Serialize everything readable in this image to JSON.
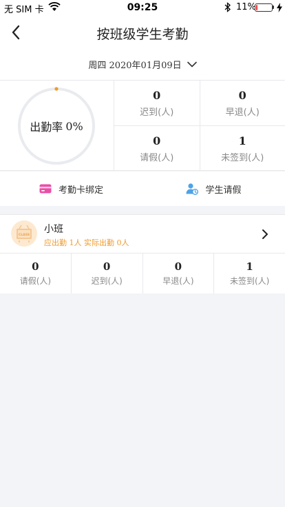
{
  "status": {
    "carrier": "无 SIM 卡",
    "time": "09:25",
    "battery": "11%",
    "battery_level": 0.11
  },
  "nav": {
    "title": "按班级学生考勤"
  },
  "date": {
    "text": "周四 2020年01月09日"
  },
  "summary": {
    "rate_label": "出勤率",
    "rate_value": "0%",
    "rate_fraction": 0,
    "stats": [
      {
        "value": "0",
        "label": "迟到(人)"
      },
      {
        "value": "0",
        "label": "早退(人)"
      },
      {
        "value": "0",
        "label": "请假(人)"
      },
      {
        "value": "1",
        "label": "未签到(人)"
      }
    ]
  },
  "actions": [
    {
      "label": "考勤卡绑定",
      "icon": "card-icon"
    },
    {
      "label": "学生请假",
      "icon": "student-leave-icon"
    }
  ],
  "class": {
    "name": "小班",
    "expected_label": "应出勤",
    "expected_value": "1人",
    "actual_label": "实际出勤",
    "actual_value": "0人",
    "avatar_text": "CLASS",
    "stats": [
      {
        "value": "0",
        "label": "请假(人)"
      },
      {
        "value": "0",
        "label": "迟到(人)"
      },
      {
        "value": "0",
        "label": "早退(人)"
      },
      {
        "value": "1",
        "label": "未签到(人)"
      }
    ]
  },
  "colors": {
    "accent": "#f19a2a",
    "card_icon": "#e94fa6",
    "leave_icon": "#4da3e8",
    "battery_low": "#ee3333"
  }
}
